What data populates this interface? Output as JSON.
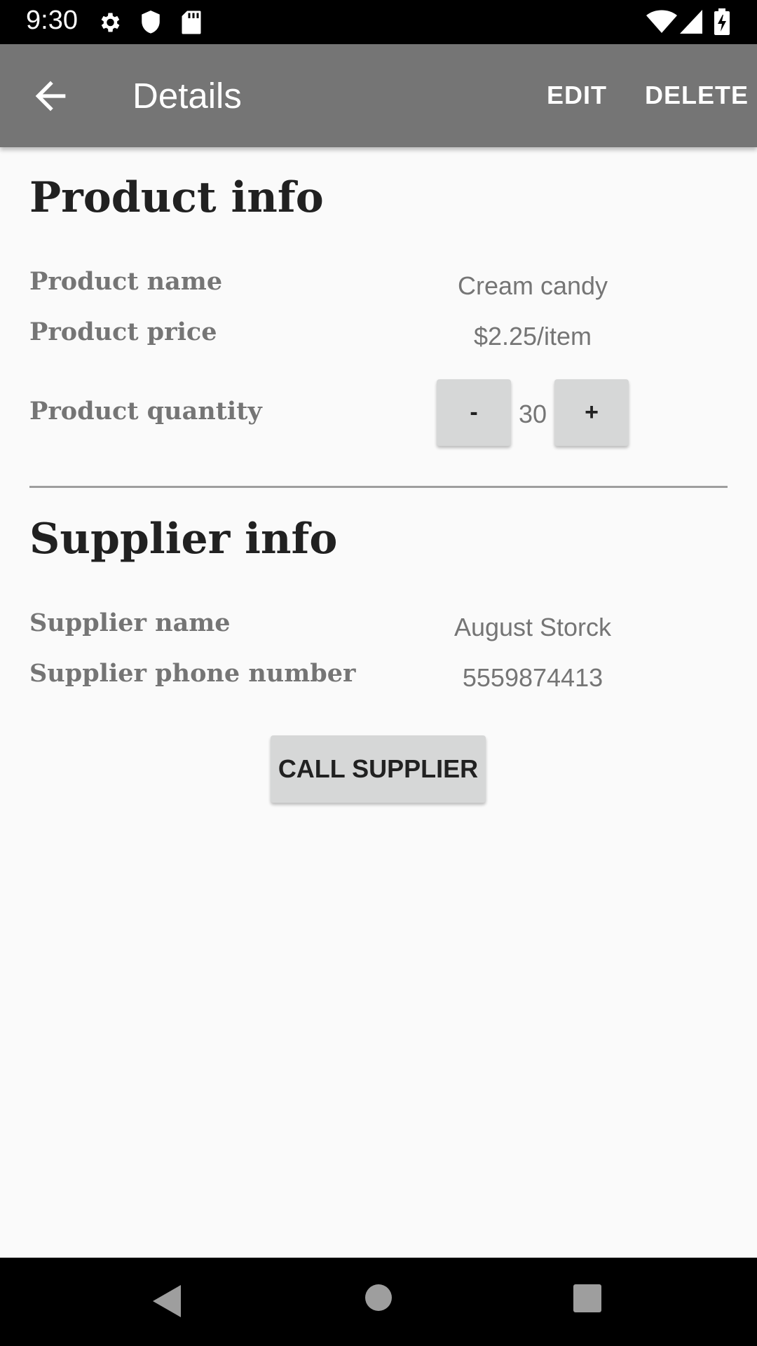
{
  "status_bar": {
    "time": "9:30",
    "icons": [
      "settings-icon",
      "shield-icon",
      "sd-card-icon",
      "wifi-icon",
      "signal-icon",
      "battery-icon"
    ]
  },
  "app_bar": {
    "title": "Details",
    "edit_label": "EDIT",
    "delete_label": "DELETE",
    "background": "#757575"
  },
  "product": {
    "section_title": "Product info",
    "name_label": "Product name",
    "name_value": "Cream candy",
    "price_label": "Product price",
    "price_value": "$2.25/item",
    "quantity_label": "Product quantity",
    "decrease_label": "-",
    "quantity_value": "30",
    "increase_label": "+"
  },
  "supplier": {
    "section_title": "Supplier info",
    "name_label": "Supplier name",
    "name_value": "August Storck",
    "phone_label": "Supplier phone number",
    "phone_value": "5559874413",
    "call_button_label": "CALL SUPPLIER"
  },
  "nav_bar": {
    "icons": [
      "back-triangle-icon",
      "home-circle-icon",
      "recents-square-icon"
    ]
  }
}
